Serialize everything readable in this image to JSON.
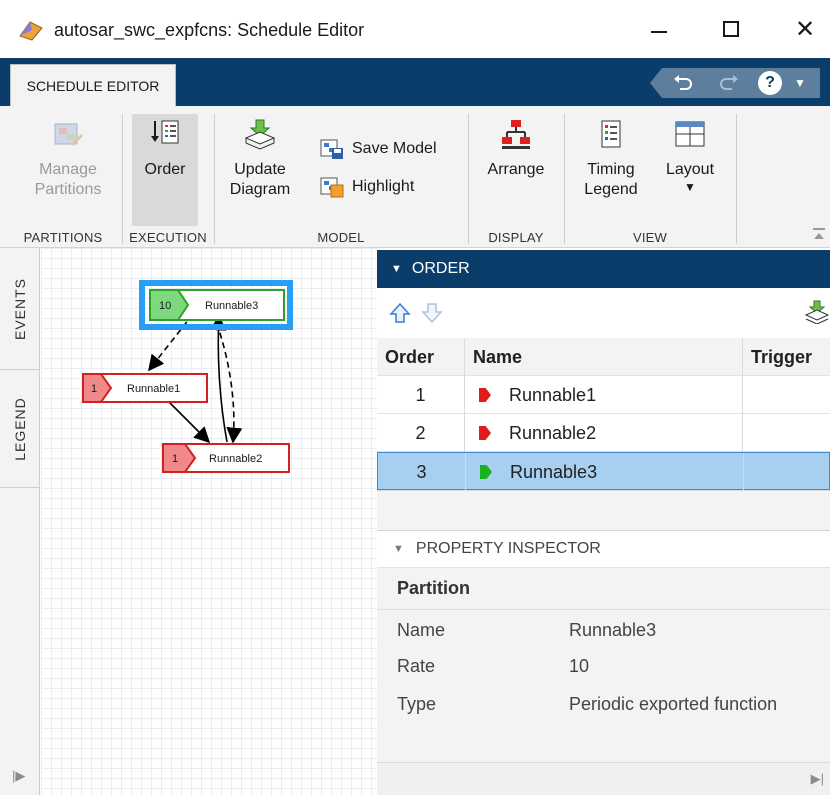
{
  "window": {
    "title": "autosar_swc_expfcns: Schedule Editor",
    "minimize_icon": "minimize-icon",
    "maximize_icon": "maximize-icon",
    "close_symbol": "✕"
  },
  "tabstrip": {
    "active_tab": "SCHEDULE EDITOR",
    "quick_access": {
      "undo_icon": "undo-icon",
      "redo_icon": "redo-icon",
      "help_label": "?",
      "help_caret": "▼"
    }
  },
  "toolstrip": {
    "partitions": {
      "manage_label_1": "Manage",
      "manage_label_2": "Partitions",
      "section": "PARTITIONS",
      "enabled": false
    },
    "execution": {
      "order_label": "Order",
      "section": "EXECUTION",
      "active": true
    },
    "model": {
      "update_label_1": "Update",
      "update_label_2": "Diagram",
      "save_label": "Save Model",
      "highlight_label": "Highlight",
      "section": "MODEL"
    },
    "display": {
      "arrange_label": "Arrange",
      "section": "DISPLAY"
    },
    "view": {
      "timing_label_1": "Timing",
      "timing_label_2": "Legend",
      "layout_label": "Layout",
      "layout_caret": "▼",
      "section": "VIEW"
    }
  },
  "side_tabs": {
    "events": "EVENTS",
    "legend": "LEGEND",
    "expand_arrow": "|▶"
  },
  "diagram": {
    "nodes": [
      {
        "id": "runnable3",
        "badge": "10",
        "label": "Runnable3",
        "kind": "periodic",
        "selected": true
      },
      {
        "id": "runnable1",
        "badge": "1",
        "label": "Runnable1",
        "kind": "aperiodic",
        "selected": false
      },
      {
        "id": "runnable2",
        "badge": "1",
        "label": "Runnable2",
        "kind": "aperiodic",
        "selected": false
      }
    ],
    "colors": {
      "periodic_fill": "#7ed87e",
      "periodic_border": "#2aa52a",
      "aperiodic_fill": "#f08a8a",
      "aperiodic_border": "#d42020",
      "selection": "#2a9df4"
    }
  },
  "order_panel": {
    "title": "ORDER",
    "toolbar": {
      "move_up_icon": "arrow-up-icon",
      "move_down_icon": "arrow-down-icon",
      "update_icon": "update-diagram-icon"
    },
    "columns": {
      "order": "Order",
      "name": "Name",
      "trigger": "Trigger"
    },
    "rows": [
      {
        "order": "1",
        "name": "Runnable1",
        "trigger": "",
        "marker_color": "#e01b1b",
        "selected": false
      },
      {
        "order": "2",
        "name": "Runnable2",
        "trigger": "",
        "marker_color": "#e01b1b",
        "selected": false
      },
      {
        "order": "3",
        "name": "Runnable3",
        "trigger": "",
        "marker_color": "#19b21f",
        "selected": true
      }
    ]
  },
  "property_inspector": {
    "title": "PROPERTY INSPECTOR",
    "section": "Partition",
    "name_key": "Name",
    "name_value": "Runnable3",
    "rate_key": "Rate",
    "rate_value": "10",
    "type_key": "Type",
    "type_value": "Periodic exported function",
    "scroll_arrow": "▶|"
  }
}
